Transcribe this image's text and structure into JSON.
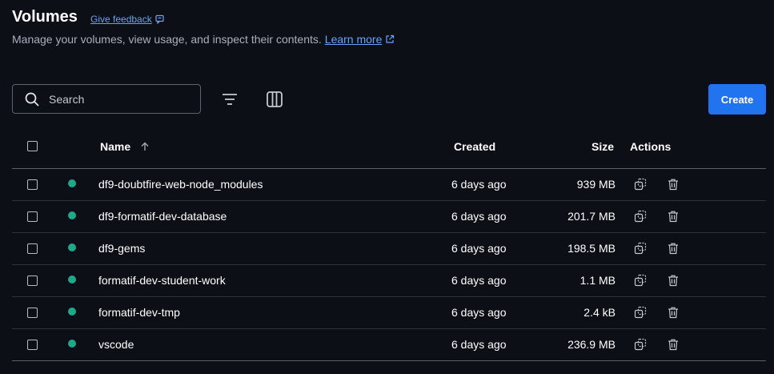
{
  "header": {
    "title": "Volumes",
    "feedback_label": "Give feedback",
    "subtitle": "Manage your volumes, view usage, and inspect their contents.",
    "learn_more_label": "Learn more"
  },
  "toolbar": {
    "search_placeholder": "Search",
    "create_label": "Create"
  },
  "table": {
    "columns": {
      "name": "Name",
      "created": "Created",
      "size": "Size",
      "actions": "Actions"
    },
    "rows": [
      {
        "name": "df9-doubtfire-web-node_modules",
        "created": "6 days ago",
        "size": "939 MB"
      },
      {
        "name": "df9-formatif-dev-database",
        "created": "6 days ago",
        "size": "201.7 MB"
      },
      {
        "name": "df9-gems",
        "created": "6 days ago",
        "size": "198.5 MB"
      },
      {
        "name": "formatif-dev-student-work",
        "created": "6 days ago",
        "size": "1.1 MB"
      },
      {
        "name": "formatif-dev-tmp",
        "created": "6 days ago",
        "size": "2.4 kB"
      },
      {
        "name": "vscode",
        "created": "6 days ago",
        "size": "236.9 MB"
      }
    ]
  },
  "colors": {
    "accent": "#2173f0",
    "link": "#6aa0ff",
    "status_in_use": "#1fa88a",
    "background": "#0c0f15"
  }
}
